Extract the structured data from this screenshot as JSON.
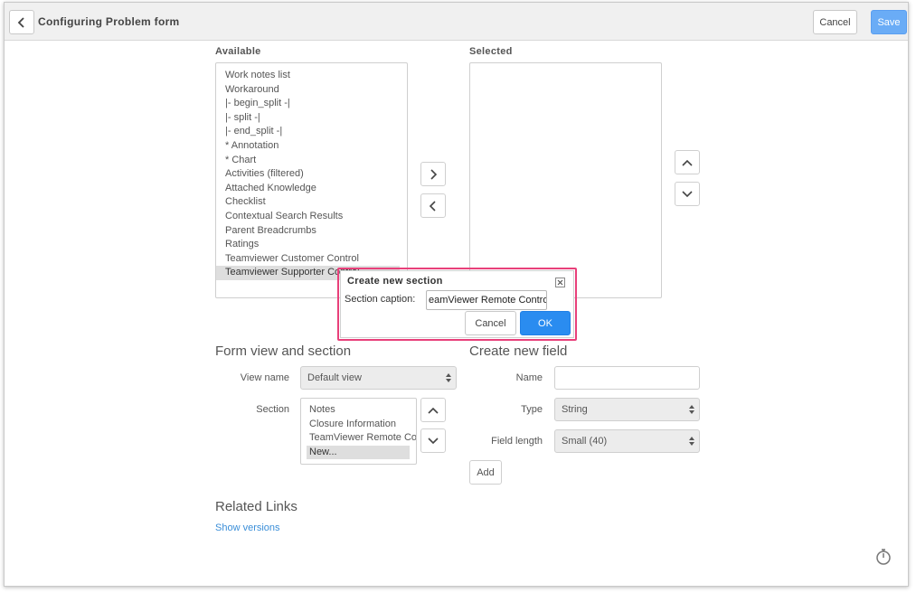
{
  "header": {
    "title": "Configuring Problem form",
    "cancel_label": "Cancel",
    "save_label": "Save",
    "back_icon": "chevron-left-icon"
  },
  "available": {
    "label": "Available",
    "items": [
      "Work notes list",
      "Workaround",
      "|- begin_split -|",
      "|- split -|",
      "|- end_split -|",
      "* Annotation",
      "* Chart",
      "Activities (filtered)",
      "Attached Knowledge",
      "Checklist",
      "Contextual Search Results",
      "Parent Breadcrumbs",
      "Ratings",
      "Teamviewer Customer Control",
      "Teamviewer Supporter Control"
    ],
    "selected_index": 14
  },
  "selected": {
    "label": "Selected",
    "items": []
  },
  "form_view": {
    "title": "Form view and section",
    "view_name_label": "View name",
    "view_name_value": "Default view",
    "section_label": "Section",
    "sections": [
      "Notes",
      "Closure Information",
      "TeamViewer Remote Control",
      "New..."
    ],
    "selected_section_index": 3
  },
  "new_field": {
    "title": "Create new field",
    "name_label": "Name",
    "name_value": "",
    "type_label": "Type",
    "type_value": "String",
    "length_label": "Field length",
    "length_value": "Small (40)",
    "add_label": "Add"
  },
  "related": {
    "title": "Related Links",
    "show_versions": "Show versions"
  },
  "dialog": {
    "title": "Create new section",
    "caption_label": "Section caption:",
    "caption_value": "eamViewer Remote Control",
    "cancel_label": "Cancel",
    "ok_label": "OK"
  },
  "colors": {
    "highlight": "#e8407a",
    "primary": "#2a8cf0",
    "link": "#3a8ed8"
  }
}
